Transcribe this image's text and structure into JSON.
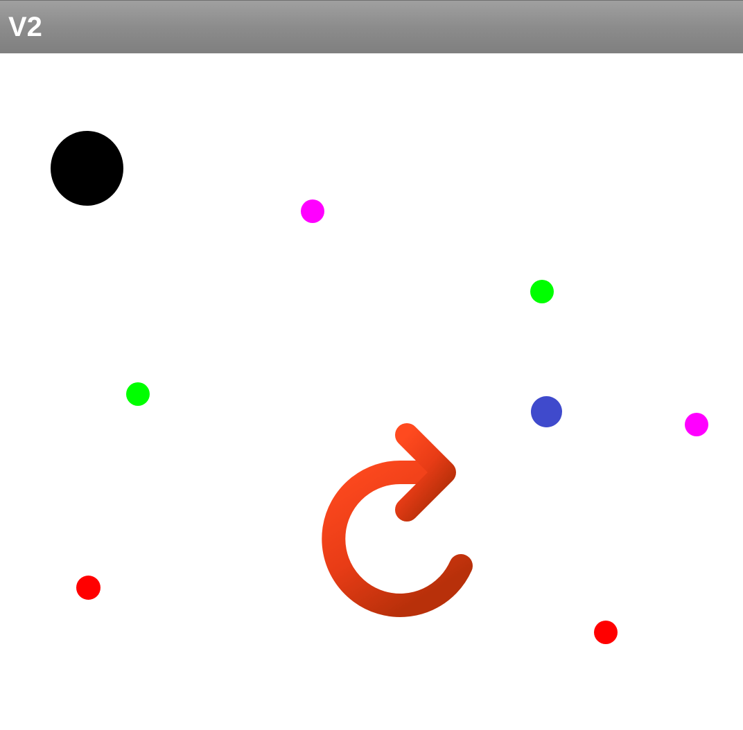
{
  "header": {
    "title": "V2"
  },
  "colors": {
    "title_bar": "#8c8c8c",
    "player": "#000000",
    "magenta_dot": "#ff00ff",
    "green_dot": "#00ff00",
    "red_dot": "#ff0000",
    "blue_dot": "#3f4acc",
    "restart_icon": "#f04020"
  },
  "game": {
    "objects": [
      {
        "name": "player-ball",
        "kind": "player",
        "color": "#000000"
      },
      {
        "name": "magenta-dot",
        "kind": "pickup",
        "color": "#ff00ff"
      },
      {
        "name": "green-dot",
        "kind": "pickup",
        "color": "#00ff00"
      },
      {
        "name": "green-dot",
        "kind": "pickup",
        "color": "#00ff00"
      },
      {
        "name": "blue-dot",
        "kind": "pickup",
        "color": "#3f4acc"
      },
      {
        "name": "magenta-dot",
        "kind": "pickup",
        "color": "#ff00ff"
      },
      {
        "name": "red-dot",
        "kind": "pickup",
        "color": "#ff0000"
      },
      {
        "name": "red-dot",
        "kind": "pickup",
        "color": "#ff0000"
      }
    ],
    "restart_icon": "restart-icon"
  }
}
